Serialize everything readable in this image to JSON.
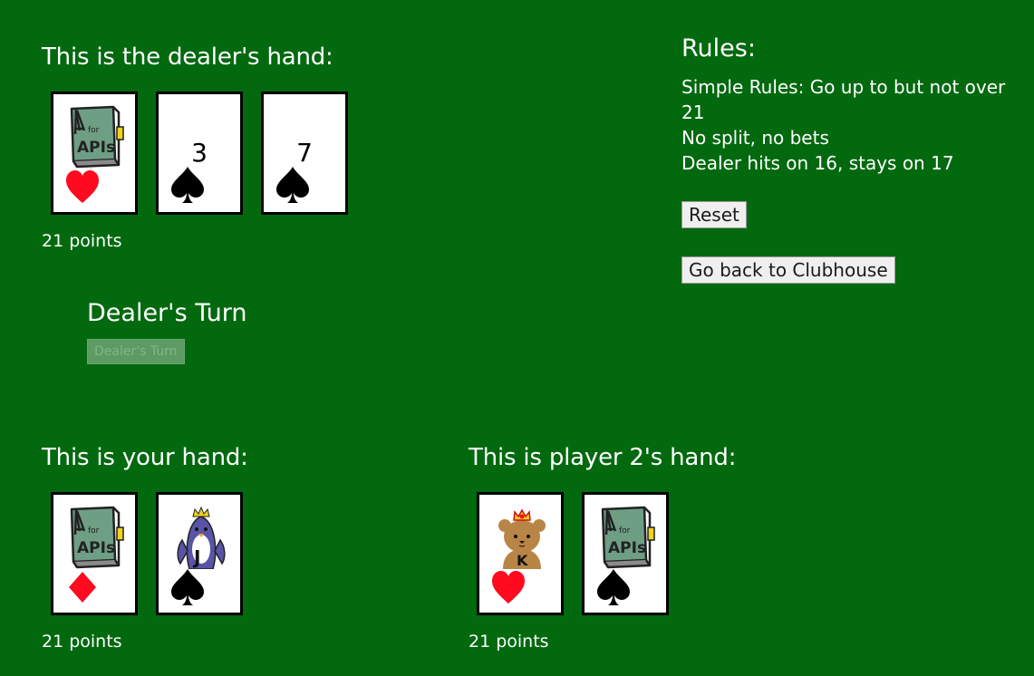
{
  "dealer": {
    "title": "This is the dealer's hand:",
    "points": "21 points",
    "cards": [
      {
        "rank": "A",
        "suit": "hearts",
        "art_icon": "api-book-icon",
        "art_text": "A for APIs"
      },
      {
        "rank": "3",
        "suit": "spades"
      },
      {
        "rank": "7",
        "suit": "spades"
      }
    ]
  },
  "turn": {
    "title": "Dealer's Turn",
    "button_label": "Dealer's Turn"
  },
  "player": {
    "title": "This is your hand:",
    "points": "21 points",
    "cards": [
      {
        "rank": "A",
        "suit": "diamonds",
        "art_icon": "api-book-icon",
        "art_text": "A for APIs"
      },
      {
        "rank": "J",
        "suit": "spades",
        "art_icon": "penguin-jack-icon"
      }
    ]
  },
  "player2": {
    "title": "This is player 2's hand:",
    "points": "21 points",
    "cards": [
      {
        "rank": "K",
        "suit": "hearts",
        "art_icon": "bear-king-icon"
      },
      {
        "rank": "A",
        "suit": "spades",
        "art_icon": "api-book-icon",
        "art_text": "A for APIs"
      }
    ]
  },
  "rules": {
    "title": "Rules:",
    "line1": "Simple Rules: Go up to but not over 21",
    "line2": "No split, no bets",
    "line3": "Dealer hits on 16, stays on 17",
    "reset_label": "Reset",
    "clubhouse_label": "Go back to Clubhouse"
  },
  "colors": {
    "table_green": "#02690f",
    "heart_red": "#ff0a1f",
    "book_green": "#6e9e84"
  }
}
